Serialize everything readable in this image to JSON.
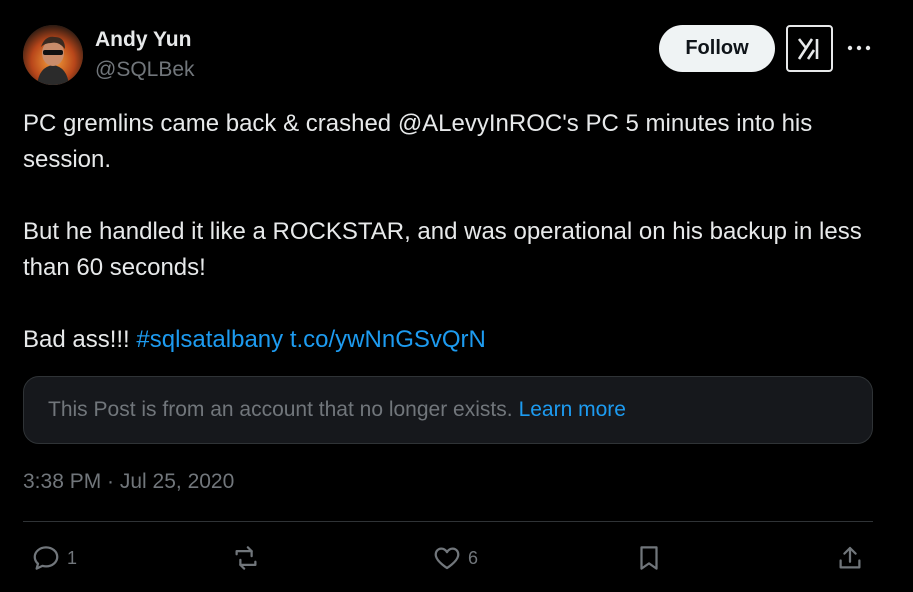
{
  "author": {
    "name": "Andy Yun",
    "handle": "@SQLBek",
    "avatar_icon": "profile-photo"
  },
  "header": {
    "follow_label": "Follow",
    "grok_icon": "grok-logo-icon",
    "more_icon": "more-horizontal-icon"
  },
  "post": {
    "line1": "PC gremlins came back & crashed @ALevyInROC's PC 5 minutes into his session.",
    "line2": "But he handled it like a ROCKSTAR, and was operational on his backup in less than 60 seconds!",
    "line3_prefix": "Bad ass!!! ",
    "hashtag": "#sqlsatalbany",
    "url": "t.co/ywNnGSvQrN"
  },
  "notice": {
    "text": "This Post is from an account that no longer exists.",
    "learn_more": "Learn more"
  },
  "timestamp": "3:38 PM · Jul 25, 2020",
  "actions": {
    "reply_count": "1",
    "like_count": "6"
  },
  "colors": {
    "background": "#000000",
    "text": "#e7e9ea",
    "muted": "#71767b",
    "link": "#1d9bf0"
  }
}
